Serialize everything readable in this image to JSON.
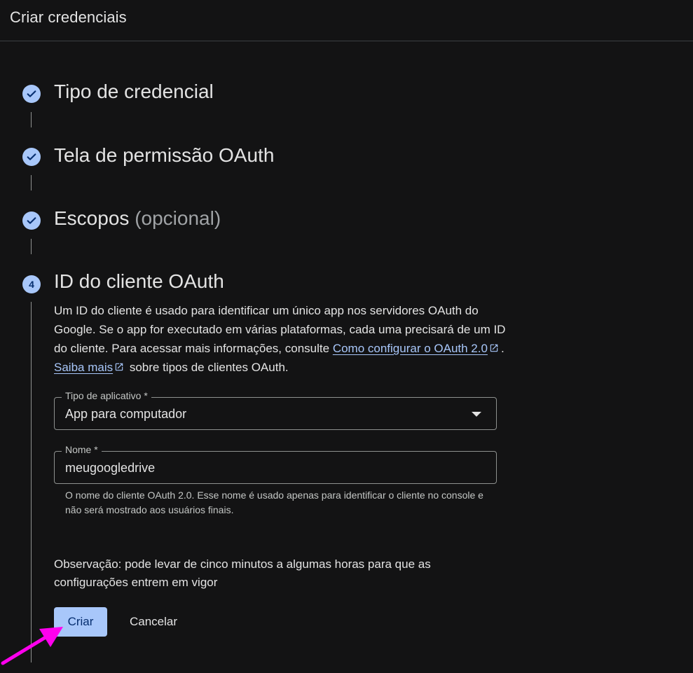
{
  "header": {
    "title": "Criar credenciais"
  },
  "steps": [
    {
      "title": "Tipo de credencial",
      "status": "done"
    },
    {
      "title": "Tela de permissão OAuth",
      "status": "done"
    },
    {
      "title": "Escopos",
      "title_suffix": "(opcional)",
      "status": "done"
    },
    {
      "number": "4",
      "title": "ID do cliente OAuth",
      "status": "current"
    }
  ],
  "description": {
    "text_1": "Um ID do cliente é usado para identificar um único app nos servidores OAuth do Google. Se o app for executado em várias plataformas, cada uma precisará de um ID do cliente. Para acessar mais informações, consulte ",
    "link_1": "Como configurar o OAuth 2.0",
    "sep": ". ",
    "link_2": "Saiba mais",
    "text_2": " sobre tipos de clientes OAuth."
  },
  "app_type_field": {
    "label": "Tipo de aplicativo *",
    "value": "App para computador"
  },
  "name_field": {
    "label": "Nome *",
    "value": "meugoogledrive",
    "helper": "O nome do cliente OAuth 2.0. Esse nome é usado apenas para identificar o cliente no console e não será mostrado aos usuários finais."
  },
  "note": "Observação: pode levar de cinco minutos a algumas horas para que as configurações entrem em vigor",
  "actions": {
    "create_label": "Criar",
    "cancel_label": "Cancelar"
  },
  "colors": {
    "background": "#131314",
    "accent": "#a8c7fa",
    "link": "#a8c7fa",
    "annotation_arrow": "#ff00ee"
  },
  "icons": {
    "step_done": "check-icon",
    "external_link": "open-in-new-icon",
    "dropdown": "arrow-drop-down-icon"
  }
}
